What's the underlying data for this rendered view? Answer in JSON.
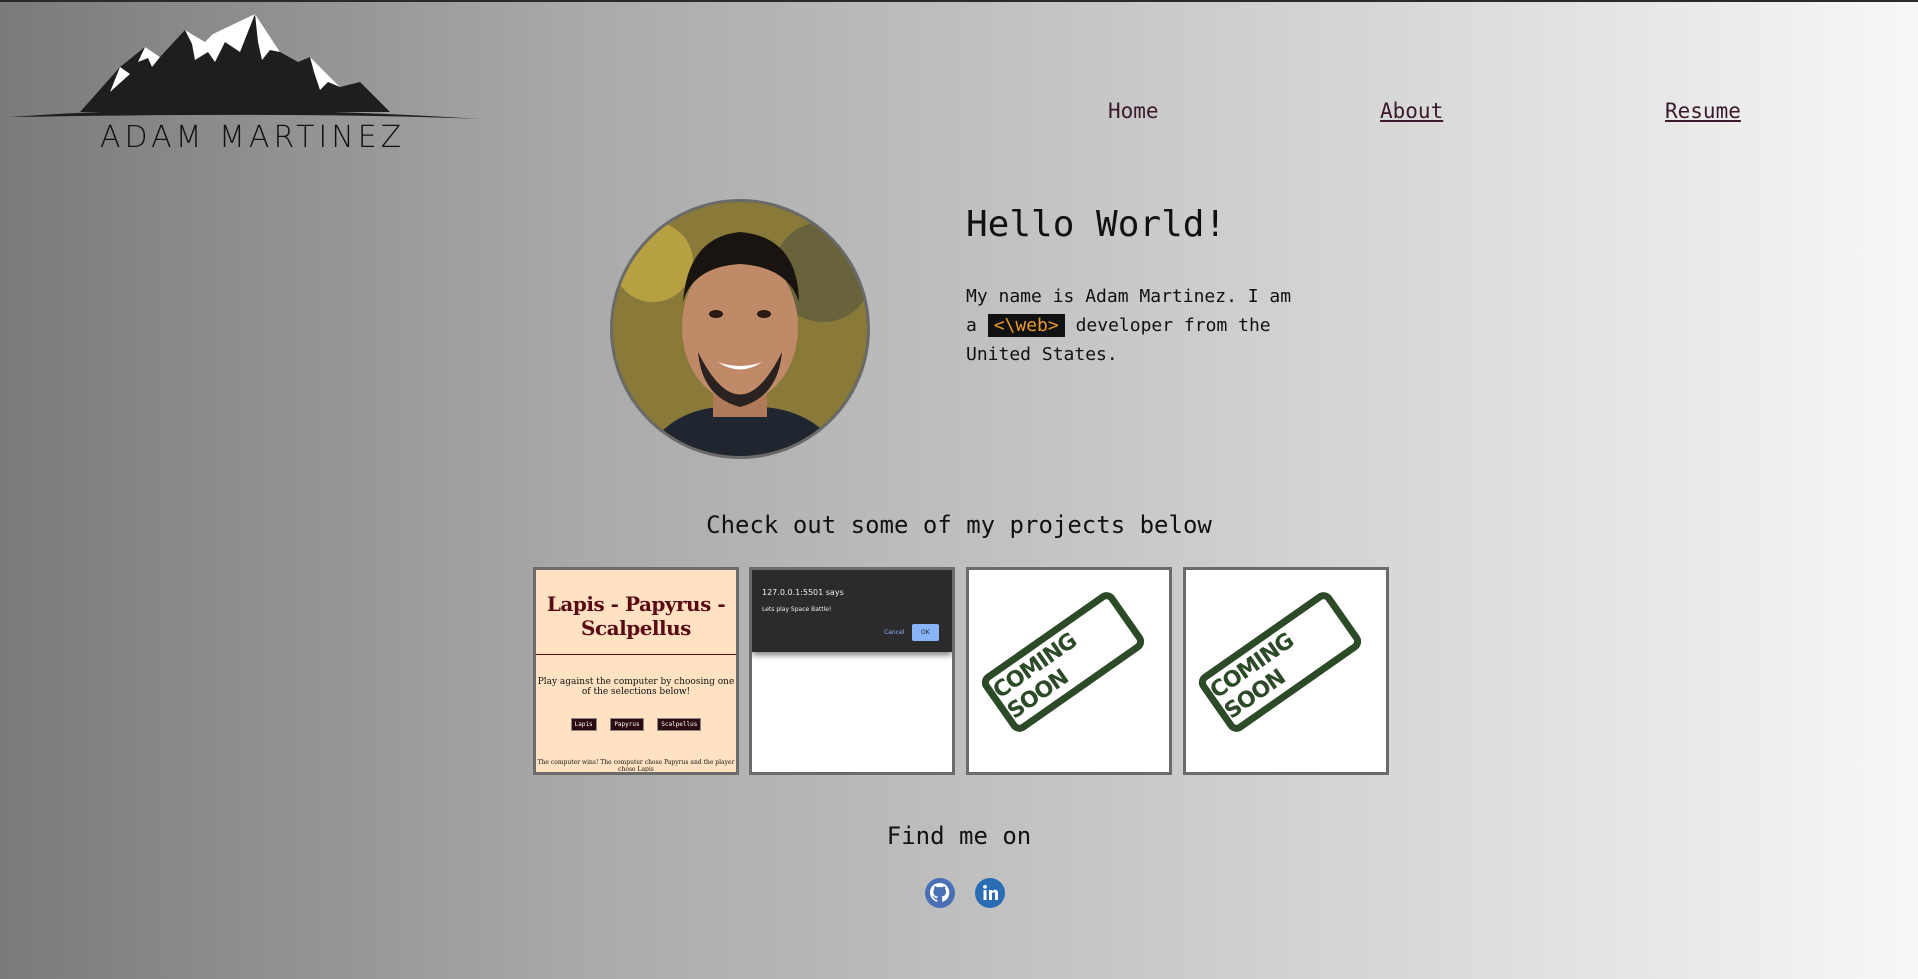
{
  "brand": {
    "name": "ADAM MARTINEZ"
  },
  "nav": {
    "home": "Home",
    "about": "About",
    "resume": "Resume"
  },
  "hero": {
    "greeting": "Hello World!",
    "intro_before": "My name is Adam Martinez. I am a",
    "tag": "<\\web>",
    "intro_after": "developer from the United States."
  },
  "projects": {
    "title": "Check out some of my projects below",
    "items": [
      {
        "title": "Lapis - Papyrus - Scalpellus",
        "subtitle": "Play against the computer by choosing one of the selections below!",
        "buttons": [
          "Lapis",
          "Papyrus",
          "Scalpellus"
        ],
        "result": "The computer wins! The computer chose Papyrus and the player chose Lapis"
      },
      {
        "dialog_title": "127.0.0.1:5501 says",
        "dialog_message": "Lets play Space Battle!",
        "cancel": "Cancel",
        "ok": "OK"
      },
      {
        "label": "COMING SOON"
      },
      {
        "label": "COMING SOON"
      }
    ]
  },
  "social": {
    "title": "Find me on",
    "icons": [
      "github-icon",
      "linkedin-icon"
    ],
    "github_color": "#4a6fb5",
    "linkedin_color": "#2a6db5"
  },
  "colors": {
    "nav_link": "#3a1a2c",
    "tag_bg": "#111111",
    "tag_fg": "#e89a2a",
    "coming_soon": "#2d4a28"
  }
}
